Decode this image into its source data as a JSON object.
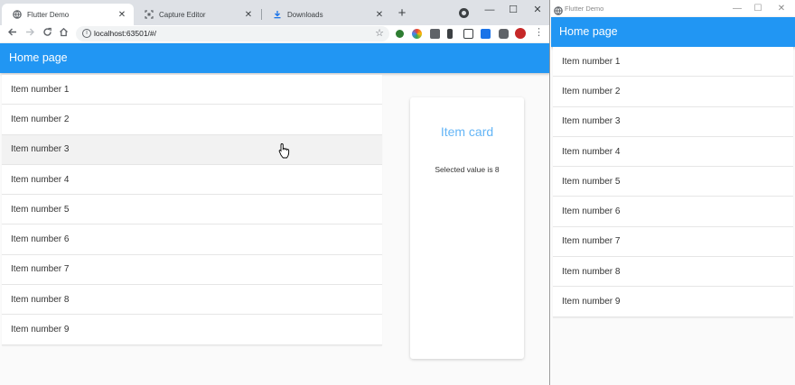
{
  "browser": {
    "tabs": [
      {
        "title": "Flutter Demo",
        "icon": "globe-icon",
        "active": true
      },
      {
        "title": "Capture Editor",
        "icon": "capture-icon",
        "active": false
      },
      {
        "title": "Downloads",
        "icon": "download-icon",
        "active": false
      }
    ],
    "close_glyph": "✕",
    "new_tab": "+",
    "url": "localhost:63501/#/",
    "info_glyph": "i",
    "window_controls": {
      "minimize": "—",
      "maximize": "☐",
      "close": "✕"
    }
  },
  "app": {
    "title": "Home page",
    "items": [
      "Item number 1",
      "Item number 2",
      "Item number 3",
      "Item number 4",
      "Item number 5",
      "Item number 6",
      "Item number 7",
      "Item number 8",
      "Item number 9"
    ],
    "hovered_index": 2,
    "card": {
      "title": "Item card",
      "value_text": "Selected value is 8"
    }
  },
  "second_window": {
    "title": "Flutter Demo",
    "app_title": "Home page",
    "items": [
      "Item number 1",
      "Item number 2",
      "Item number 3",
      "Item number 4",
      "Item number 5",
      "Item number 6",
      "Item number 7",
      "Item number 8",
      "Item number 9"
    ],
    "window_controls": {
      "minimize": "—",
      "maximize": "☐",
      "close": "✕"
    }
  },
  "colors": {
    "appbar": "#2196f3",
    "card_title": "#64b5f6",
    "tabstrip": "#dee1e6"
  }
}
